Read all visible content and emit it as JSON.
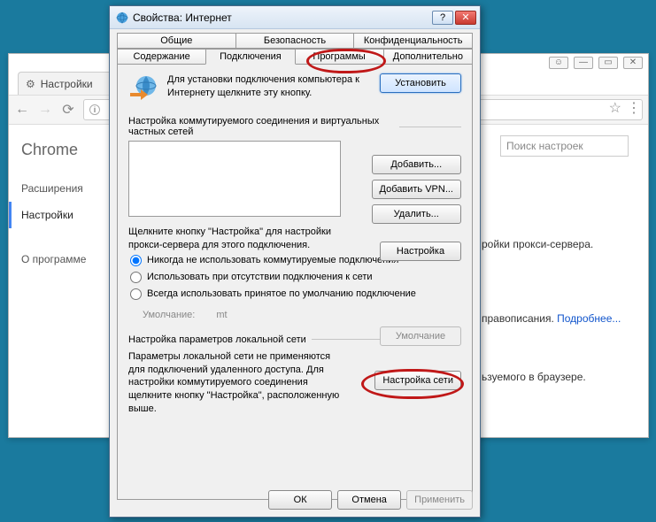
{
  "chrome": {
    "tab_title": "Настройки",
    "side_title": "Chrome",
    "side_items": [
      "Расширения",
      "Настройки",
      "О программе"
    ],
    "search_placeholder": "Поиск настроек",
    "text_proxy": "ройки прокси-сервера.",
    "text_spell": "правописания.",
    "text_more": "Подробнее...",
    "text_browser": "ьзуемого в браузере."
  },
  "dlg": {
    "title": "Свойства: Интернет",
    "tabs_row1": [
      "Общие",
      "Безопасность",
      "Конфиденциальность"
    ],
    "tabs_row2": [
      "Содержание",
      "Подключения",
      "Программы",
      "Дополнительно"
    ],
    "setup_text": "Для установки подключения компьютера к Интернету щелкните эту кнопку.",
    "btn_setup": "Установить",
    "section_dial": "Настройка коммутируемого соединения и виртуальных частных сетей",
    "btn_add": "Добавить...",
    "btn_addvpn": "Добавить VPN...",
    "btn_remove": "Удалить...",
    "proxy_hint": "Щелкните кнопку \"Настройка\" для настройки прокси-сервера для этого подключения.",
    "btn_settings": "Настройка",
    "radio_never": "Никогда не использовать коммутируемые подключения",
    "radio_absent": "Использовать при отсутствии подключения к сети",
    "radio_always": "Всегда использовать принятое по умолчанию подключение",
    "default_label": "Умолчание:",
    "default_value": "mt",
    "btn_default": "Умолчание",
    "section_lan": "Настройка параметров локальной сети",
    "lan_desc": "Параметры локальной сети не применяются для подключений удаленного доступа. Для настройки коммутируемого соединения щелкните кнопку \"Настройка\", расположенную выше.",
    "btn_lan": "Настройка сети",
    "btn_ok": "ОК",
    "btn_cancel": "Отмена",
    "btn_apply": "Применить"
  }
}
